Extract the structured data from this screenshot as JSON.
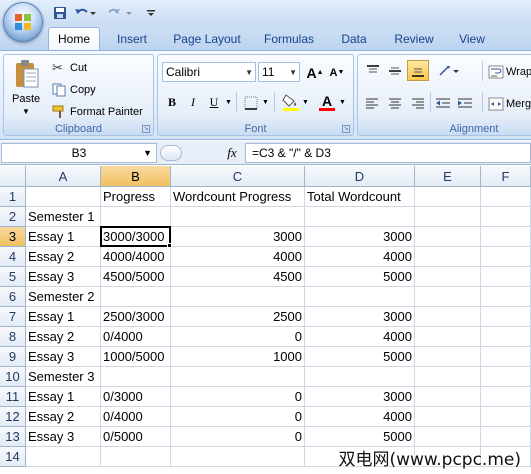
{
  "quick_access": {
    "icons": [
      "save-icon",
      "undo-icon",
      "redo-icon",
      "customize-icon"
    ]
  },
  "tabs": [
    {
      "label": "Home",
      "active": true
    },
    {
      "label": "Insert"
    },
    {
      "label": "Page Layout"
    },
    {
      "label": "Formulas"
    },
    {
      "label": "Data"
    },
    {
      "label": "Review"
    },
    {
      "label": "View"
    }
  ],
  "clipboard": {
    "paste_label": "Paste",
    "cut_label": "Cut",
    "copy_label": "Copy",
    "format_painter_label": "Format Painter",
    "group_label": "Clipboard"
  },
  "font": {
    "family": "Calibri",
    "size": "11",
    "group_label": "Font",
    "bold": "B",
    "italic": "I",
    "underline": "U",
    "grow": "A",
    "shrink": "A",
    "color_label": "A",
    "font_color": "#ff0000",
    "fill_color": "#ffff00"
  },
  "alignment": {
    "wrap_label": "Wrap",
    "merge_label": "Merg",
    "group_label": "Alignment"
  },
  "formula_bar": {
    "cell_ref": "B3",
    "fx": "fx",
    "formula": "=C3 & \"/\" & D3"
  },
  "sheet": {
    "columns": [
      "A",
      "B",
      "C",
      "D",
      "E",
      "F"
    ],
    "selected_column": "B",
    "selected_row": "3",
    "rows": [
      {
        "n": "1",
        "a": "",
        "b": "Progress",
        "c": "Wordcount Progress",
        "d": "Total Wordcount"
      },
      {
        "n": "2",
        "a": "Semester 1",
        "b": "",
        "c": "",
        "d": ""
      },
      {
        "n": "3",
        "a": "Essay 1",
        "b": "3000/3000",
        "c": "3000",
        "d": "3000"
      },
      {
        "n": "4",
        "a": "Essay 2",
        "b": "4000/4000",
        "c": "4000",
        "d": "4000"
      },
      {
        "n": "5",
        "a": "Essay 3",
        "b": "4500/5000",
        "c": "4500",
        "d": "5000"
      },
      {
        "n": "6",
        "a": "Semester 2",
        "b": "",
        "c": "",
        "d": ""
      },
      {
        "n": "7",
        "a": "Essay 1",
        "b": "2500/3000",
        "c": "2500",
        "d": "3000"
      },
      {
        "n": "8",
        "a": "Essay 2",
        "b": "0/4000",
        "c": "0",
        "d": "4000"
      },
      {
        "n": "9",
        "a": "Essay 3",
        "b": "1000/5000",
        "c": "1000",
        "d": "5000"
      },
      {
        "n": "10",
        "a": "Semester 3",
        "b": "",
        "c": "",
        "d": ""
      },
      {
        "n": "11",
        "a": "Essay 1",
        "b": "0/3000",
        "c": "0",
        "d": "3000"
      },
      {
        "n": "12",
        "a": "Essay 2",
        "b": "0/4000",
        "c": "0",
        "d": "4000"
      },
      {
        "n": "13",
        "a": "Essay 3",
        "b": "0/5000",
        "c": "0",
        "d": "5000"
      },
      {
        "n": "14",
        "a": "",
        "b": "",
        "c": "",
        "d": ""
      }
    ]
  },
  "watermark": "双电网(www.pcpc.me)"
}
